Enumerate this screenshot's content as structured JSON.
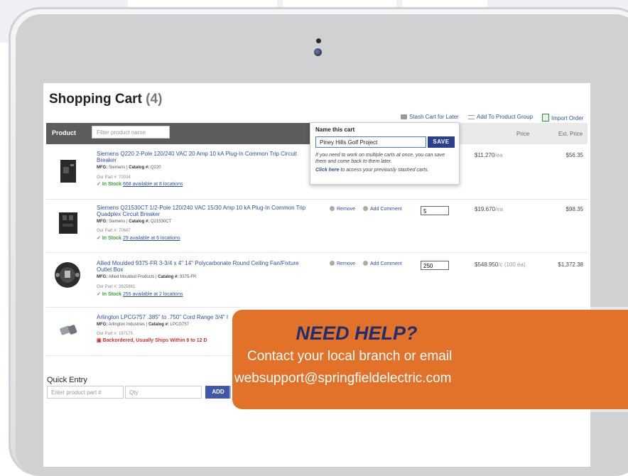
{
  "cart": {
    "title": "Shopping Cart",
    "count": "(4)",
    "actions": {
      "stash": "Stash Cart for Later",
      "add_group": "Add To Product Group",
      "import": "Import Order"
    },
    "table": {
      "product_header": "Product",
      "filter_placeholder": "Filter product name",
      "price_header": "Price",
      "ext_price_header": "Ext. Price"
    },
    "rows": [
      {
        "name": "Siemens Q220 2-Pole 120/240 VAC 20 Amp 10 kA Plug-In Common Trip Circuit Breaker",
        "mfg_label": "MFG:",
        "mfg": "Siemens",
        "catalog_label": "Catalog #:",
        "catalog": "Q220",
        "our_part": "Our Part #: 70034",
        "stock_status": "In Stock",
        "availability": "668 available at 8 locations",
        "remove": "",
        "comment": "",
        "qty": "",
        "price": "$11.270",
        "unit": "/ea",
        "ext_price": "$56.35"
      },
      {
        "name": "Siemens Q21530CT 1/2-Pole 120/240 VAC 15/30 Amp 10 kA Plug-In Common Trip Quadplex Circuit Breaker",
        "mfg_label": "MFG:",
        "mfg": "Siemens",
        "catalog_label": "Catalog #:",
        "catalog": "Q21530CT",
        "our_part": "Our Part #: 70687",
        "stock_status": "In Stock",
        "availability": "29 available at 6 locations",
        "remove": "Remove",
        "comment": "Add Comment",
        "qty": "5",
        "price": "$19.670",
        "unit": "/ea",
        "ext_price": "$98.35"
      },
      {
        "name": "Allied Moulded 9375-FR 3-3/4 x 4\" 14\" Polycarbonate Round Ceiling Fan/Fixture Outlet Box",
        "mfg_label": "MFG:",
        "mfg": "Allied Moulded Products",
        "catalog_label": "Catalog #:",
        "catalog": "9375-FR",
        "our_part": "Our Part #: 2625861",
        "stock_status": "In Stock",
        "availability": "255 available at 2 locations",
        "remove": "Remove",
        "comment": "Add Comment",
        "qty": "250",
        "price": "$548.950",
        "unit": "/c (100 ea)",
        "ext_price": "$1,372.38"
      },
      {
        "name": "Arlington LPCG757 .385\" to .750\" Cord Range 3/4\" I",
        "mfg_label": "MFG:",
        "mfg": "Arlington Industries",
        "catalog_label": "Catalog #:",
        "catalog": "LPCG757",
        "our_part": "Our Part #: 187175",
        "backorder": "Backordered, Usually Ships Within 8 to 12 D"
      }
    ],
    "popup": {
      "title": "Name this cart",
      "value": "Piney Hills Golf Project",
      "save": "SAVE",
      "help": "If you need to work on multiple carts at once, you can save them and come back to them later.",
      "link": "Click here",
      "link_rest": " to access your previously stashed carts."
    },
    "quick_entry": {
      "title": "Quick Entry",
      "part_placeholder": "Enter product part #",
      "qty_placeholder": "Qty",
      "add": "ADD"
    }
  },
  "banner": {
    "heading": "NEED HELP?",
    "line1": "Contact your local branch or email",
    "line2": "websupport@springfieldelectric.com",
    "color": "#e2722a"
  },
  "colors": {
    "link": "#2e4fa0",
    "save_button": "#2b3f8c",
    "in_stock": "#3aa33a",
    "backorder": "#d0342c"
  }
}
